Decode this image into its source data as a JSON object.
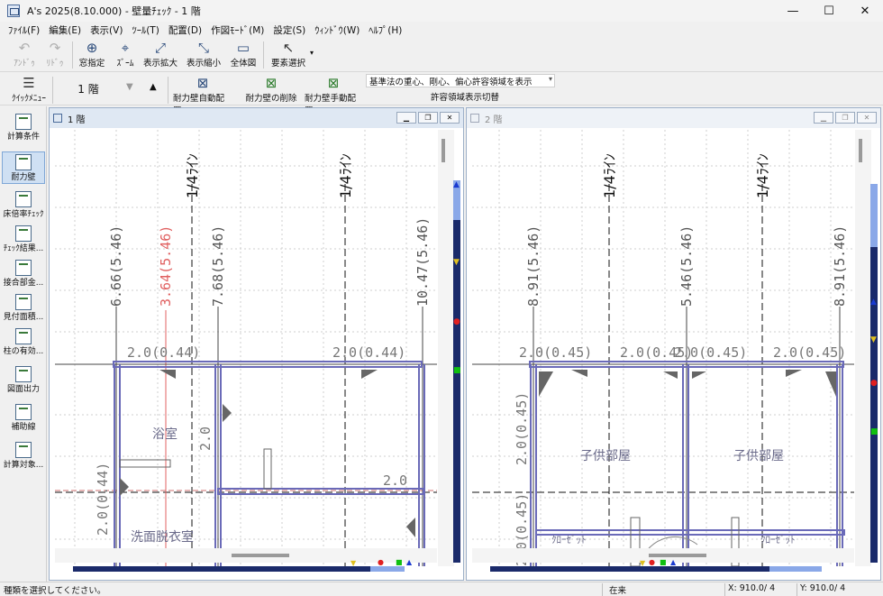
{
  "window": {
    "title": "A's 2025(8.10.000) - 壁量ﾁｪｯｸ - 1 階"
  },
  "menu": [
    "ﾌｧｲﾙ(F)",
    "編集(E)",
    "表示(V)",
    "ﾂｰﾙ(T)",
    "配置(D)",
    "作図ﾓｰﾄﾞ(M)",
    "設定(S)",
    "ｳｨﾝﾄﾞｳ(W)",
    "ﾍﾙﾌﾟ(H)"
  ],
  "toolbar": {
    "undo": "ｱﾝﾄﾞｩ",
    "redo": "ﾘﾄﾞｩ",
    "window_select": "窓指定",
    "zoom": "ｽﾞｰﾑ",
    "zoom_in": "表示拡大",
    "zoom_out": "表示縮小",
    "fit_all": "全体図",
    "select_element": "要素選択"
  },
  "toolbar2": {
    "quick_menu": "ｸｲｯｸﾒﾆｭｰ",
    "floor": "1 階",
    "auto_wall": "耐力壁自動配置",
    "auto_badge": "AUTO",
    "delete_wall": "耐力壁の削除",
    "manual_wall": "耐力壁手動配置",
    "check_option": "基準法の重心、剛心、偏心許容領域を表示",
    "check_switch": "許容領域表示切替"
  },
  "sidebar": [
    {
      "label": "計算条件"
    },
    {
      "label": "耐力壁"
    },
    {
      "label": "床倍率ﾁｪｯｸ"
    },
    {
      "label": "ﾁｪｯｸ結果..."
    },
    {
      "label": "接合部金..."
    },
    {
      "label": "見付面積..."
    },
    {
      "label": "柱の有効..."
    },
    {
      "label": "図面出力"
    },
    {
      "label": "補助線"
    },
    {
      "label": "計算対象..."
    }
  ],
  "floor1": {
    "title": "1 階",
    "axis_quarter": "1/4ﾗｲﾝ",
    "dims": [
      "6.66(5.46)",
      "3.64(5.46)",
      "7.68(5.46)",
      "10.47(5.46)"
    ],
    "wall_labels": [
      "2.0(0.44)",
      "2.0(0.44)",
      "2.0",
      "2.0",
      "2.0(0.44)"
    ],
    "rooms": [
      "浴室",
      "洗面脱衣室"
    ]
  },
  "floor2": {
    "title": "2 階",
    "axis_quarter": "1/4ﾗｲﾝ",
    "dims": [
      "8.91(5.46)",
      "5.46(5.46)",
      "8.91(5.46)"
    ],
    "wall_labels": [
      "2.0(0.45)",
      "2.0(0.45)",
      "2.0(0.45)",
      "2.0(0.45)",
      "2.0(0.45)",
      "2.0(0.45)"
    ],
    "rooms": [
      "子供部屋",
      "子供部屋",
      "ｸﾛｰｾﾞｯﾄ",
      "ｸﾛｰｾﾞｯﾄ"
    ]
  },
  "status": {
    "message": "種類を選択してください。",
    "mode": "在来",
    "x": "X: 910.0/ 4",
    "y": "Y: 910.0/ 4"
  },
  "colors": {
    "accent": "#2a4a7a",
    "wall": "#6a6ab8",
    "red_line": "#e06060",
    "dim_text": "#555555"
  }
}
